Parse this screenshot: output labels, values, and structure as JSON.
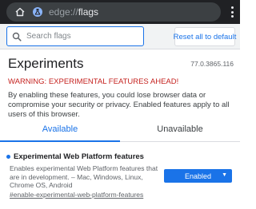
{
  "browser": {
    "url_prefix": "edge://",
    "url_path": "flags",
    "home_icon": "home-icon",
    "flags_icon": "flask-icon",
    "menu_icon": "more-vert-icon"
  },
  "search": {
    "placeholder": "Search flags",
    "value": "",
    "icon": "search-icon"
  },
  "reset_button": {
    "label": "Reset all to default"
  },
  "header": {
    "title": "Experiments",
    "version": "77.0.3865.116",
    "warning": "WARNING: EXPERIMENTAL FEATURES AHEAD!",
    "disclaimer": "By enabling these features, you could lose browser data or compromise your security or privacy. Enabled features apply to all users of this browser."
  },
  "tabs": [
    {
      "label": "Available",
      "selected": true
    },
    {
      "label": "Unavailable",
      "selected": false
    }
  ],
  "experiments": [
    {
      "title": "Experimental Web Platform features",
      "description": "Enables experimental Web Platform features that are in development. – Mac, Windows, Linux, Chrome OS, Android",
      "link": "#enable-experimental-web-platform-features",
      "state": "Enabled",
      "modified": true
    }
  ],
  "colors": {
    "accent": "#1a73e8",
    "warning": "#c5221f",
    "topbar": "#202124"
  }
}
